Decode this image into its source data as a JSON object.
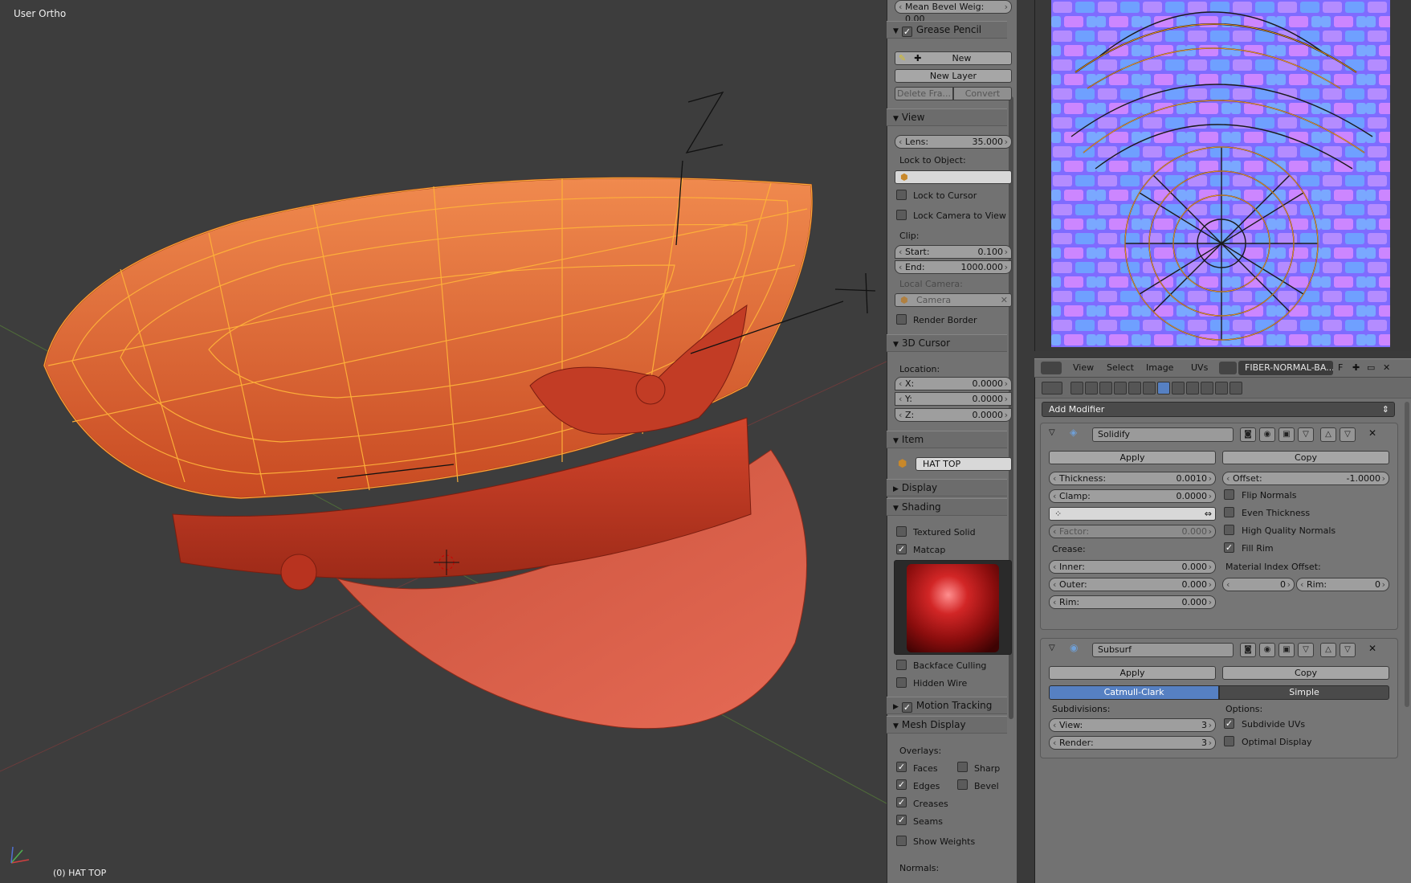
{
  "viewport": {
    "view_label": "User Ortho",
    "object_label": "(0) HAT TOP"
  },
  "npanel": {
    "mean_bevel": "Mean Bevel Weig: 0.00",
    "grease_pencil": {
      "title": "Grease Pencil",
      "new": "New",
      "new_layer": "New Layer",
      "delete_frame": "Delete Fra...",
      "convert": "Convert"
    },
    "view": {
      "title": "View",
      "lens_label": "Lens:",
      "lens_value": "35.000",
      "lock_to_object": "Lock to Object:",
      "lock_to_cursor": "Lock to Cursor",
      "lock_camera_to_view": "Lock Camera to View",
      "clip": "Clip:",
      "start_label": "Start:",
      "start_value": "0.100",
      "end_label": "End:",
      "end_value": "1000.000",
      "local_camera": "Local Camera:",
      "camera": "Camera",
      "render_border": "Render Border"
    },
    "cursor": {
      "title": "3D Cursor",
      "location": "Location:",
      "x_label": "X:",
      "x_value": "0.0000",
      "y_label": "Y:",
      "y_value": "0.0000",
      "z_label": "Z:",
      "z_value": "0.0000"
    },
    "item": {
      "title": "Item",
      "name": "HAT TOP"
    },
    "display": {
      "title": "Display"
    },
    "shading": {
      "title": "Shading",
      "textured_solid": "Textured Solid",
      "matcap": "Matcap",
      "backface_culling": "Backface Culling",
      "hidden_wire": "Hidden Wire"
    },
    "motion_tracking": {
      "title": "Motion Tracking"
    },
    "mesh_display": {
      "title": "Mesh Display",
      "overlays": "Overlays:",
      "faces": "Faces",
      "sharp": "Sharp",
      "edges": "Edges",
      "bevel": "Bevel",
      "creases": "Creases",
      "seams": "Seams",
      "show_weights": "Show Weights",
      "normals": "Normals:"
    }
  },
  "uv_header": {
    "menus": [
      "View",
      "Select",
      "Image",
      "UVs"
    ],
    "image_name": "FIBER-NORMAL-BA...",
    "fake_user": "F"
  },
  "modifiers": {
    "add_modifier": "Add Modifier",
    "solidify": {
      "name": "Solidify",
      "apply": "Apply",
      "copy": "Copy",
      "thickness_label": "Thickness:",
      "thickness_value": "0.0010",
      "offset_label": "Offset:",
      "offset_value": "-1.0000",
      "clamp_label": "Clamp:",
      "clamp_value": "0.0000",
      "flip_normals": "Flip Normals",
      "even_thickness": "Even Thickness",
      "hq_normals": "High Quality Normals",
      "fill_rim": "Fill Rim",
      "factor_label": "Factor:",
      "factor_value": "0.000",
      "crease": "Crease:",
      "inner_label": "Inner:",
      "inner_value": "0.000",
      "outer_label": "Outer:",
      "outer_value": "0.000",
      "rim_label": "Rim:",
      "rim_value": "0.000",
      "mat_index_offset": "Material Index Offset:",
      "mat_value": "0",
      "mat_rim_label": "Rim:",
      "mat_rim_value": "0"
    },
    "subsurf": {
      "name": "Subsurf",
      "apply": "Apply",
      "copy": "Copy",
      "catmull": "Catmull-Clark",
      "simple": "Simple",
      "subdivisions": "Subdivisions:",
      "options": "Options:",
      "view_label": "View:",
      "view_value": "3",
      "render_label": "Render:",
      "render_value": "3",
      "subdivide_uvs": "Subdivide UVs",
      "optimal_display": "Optimal Display"
    }
  },
  "colors": {
    "accent": "#5680c2",
    "selection": "#ff9a1a",
    "hat": "#d9532f"
  }
}
